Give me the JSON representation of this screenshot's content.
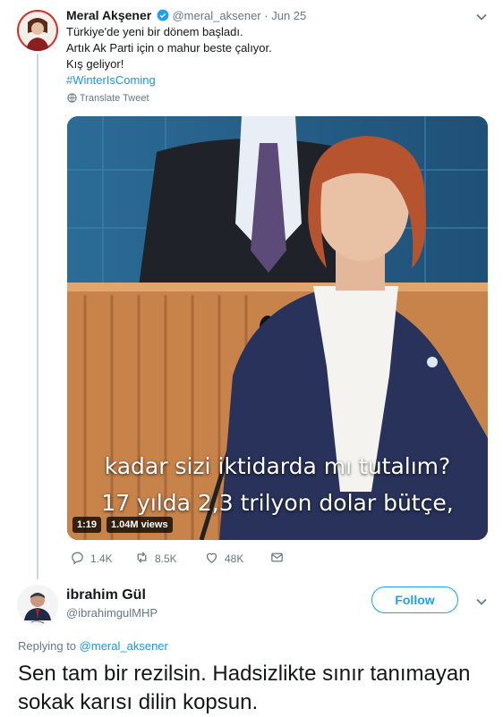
{
  "tweet": {
    "author_name": "Meral Akşener",
    "handle": "@meral_aksener",
    "separator": "·",
    "date": "Jun 25",
    "lines": [
      "Türkiye'de yeni bir dönem başladı.",
      "Artık Ak Parti için o mahur beste çalıyor.",
      "Kış geliyor!"
    ],
    "hashtag": "#WinterIsComing",
    "translate_label": "Translate Tweet",
    "video": {
      "caption_line1": "kadar sizi iktidarda mı tutalım?",
      "caption_line2": "17 yılda 2,3 trilyon dolar bütçe,",
      "duration": "1:19",
      "views": "1.04M views"
    },
    "actions": {
      "replies": "1.4K",
      "retweets": "8.5K",
      "likes": "48K"
    }
  },
  "reply_tweet": {
    "author_name": "ibrahim Gül",
    "handle": "@ibrahimgulMHP",
    "follow_label": "Follow",
    "replying_to_prefix": "Replying to",
    "replying_to_handle": "@meral_aksener",
    "text": "Sen tam bir rezilsin. Hadsizlikte sınır tanımayan sokak karısı dilin kopsun."
  },
  "colors": {
    "accent": "#1da1f2",
    "link": "#1b95e0",
    "muted": "#657786",
    "verified": "#1da1f2"
  },
  "icons": {
    "verified": "verified-badge-icon",
    "caret": "chevron-down-icon",
    "translate": "globe-icon",
    "reply": "reply-icon",
    "retweet": "retweet-icon",
    "like": "heart-icon",
    "dm": "envelope-icon"
  }
}
